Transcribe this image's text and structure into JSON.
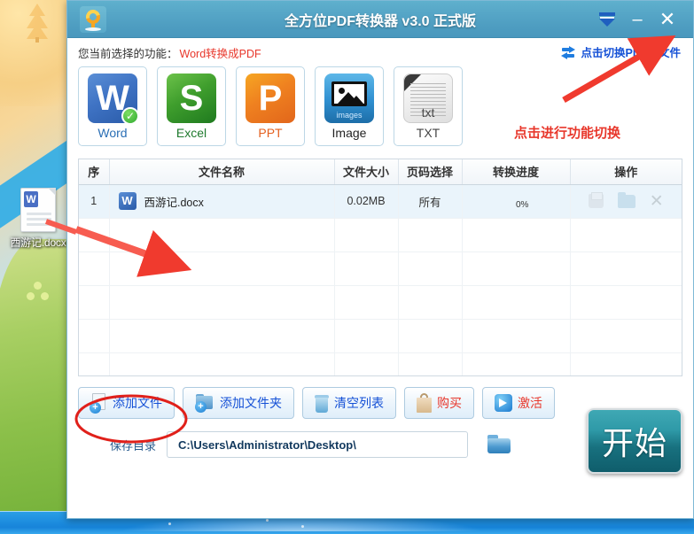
{
  "window": {
    "title": "全方位PDF转换器 v3.0 正式版",
    "logo_icon": "refresh-logo-icon",
    "controls": [
      {
        "name": "minimize-to-tray-button",
        "icon": "tray-down-arrow-icon",
        "glyph": ""
      },
      {
        "name": "minimize-button",
        "icon": "minimize-icon",
        "glyph": "–"
      },
      {
        "name": "close-button",
        "icon": "close-icon",
        "glyph": "✕"
      }
    ],
    "titlebar_color": "#4f9ec0"
  },
  "function_bar": {
    "label": "您当前选择的功能：",
    "current": "Word转换成PDF",
    "switch_link": "点击切换PDF转文件",
    "switch_icon": "swap-arrows-icon",
    "annotation": "点击进行功能切换",
    "annotation_color": "#e8372b",
    "link_color": "#1450d6"
  },
  "tiles": [
    {
      "name": "tile-word",
      "caption": "Word",
      "letter": "W",
      "selected": true,
      "badge": "✓"
    },
    {
      "name": "tile-excel",
      "caption": "Excel",
      "letter": "S",
      "selected": false,
      "badge": ""
    },
    {
      "name": "tile-ppt",
      "caption": "PPT",
      "letter": "P",
      "selected": false,
      "badge": ""
    },
    {
      "name": "tile-image",
      "caption": "Image",
      "letter": "",
      "selected": false,
      "badge": "",
      "sub": "images"
    },
    {
      "name": "tile-txt",
      "caption": "TXT",
      "letter": "",
      "selected": false,
      "badge": "",
      "sub": "txt"
    }
  ],
  "table": {
    "headers": [
      "序",
      "文件名称",
      "文件大小",
      "页码选择",
      "转换进度",
      "操作"
    ],
    "rows": [
      {
        "index": "1",
        "file_icon": "word-file-icon",
        "filename": "西游记.docx",
        "size": "0.02MB",
        "pages": "所有",
        "progress_text": "0%",
        "progress_percent": 0,
        "ops": [
          "save-icon",
          "open-folder-icon",
          "remove-icon"
        ]
      }
    ],
    "empty_rows": 5
  },
  "toolbar": [
    {
      "name": "add-file-button",
      "label": "添加文件",
      "icon": "add-file-icon",
      "color": "#1450d6",
      "highlighted": true
    },
    {
      "name": "add-folder-button",
      "label": "添加文件夹",
      "icon": "add-folder-icon",
      "color": "#1450d6",
      "highlighted": false
    },
    {
      "name": "clear-list-button",
      "label": "清空列表",
      "icon": "trash-icon",
      "color": "#1450d6",
      "highlighted": false
    },
    {
      "name": "buy-button",
      "label": "购买",
      "icon": "shopping-bag-icon",
      "color": "#e8372b",
      "highlighted": false
    },
    {
      "name": "activate-button",
      "label": "激活",
      "icon": "arrow-right-icon",
      "color": "#e8372b",
      "highlighted": false
    }
  ],
  "save_row": {
    "label": "保存目录",
    "path": "C:\\Users\\Administrator\\Desktop\\",
    "placeholder": "C:\\Users\\Administrator\\Desktop\\",
    "browse_icon": "folder-browse-icon",
    "start_label": "开始",
    "start_color": "#1d8293"
  },
  "desktop": {
    "file_icon_label": "西游记.docx",
    "file_icon": "word-document-icon"
  }
}
